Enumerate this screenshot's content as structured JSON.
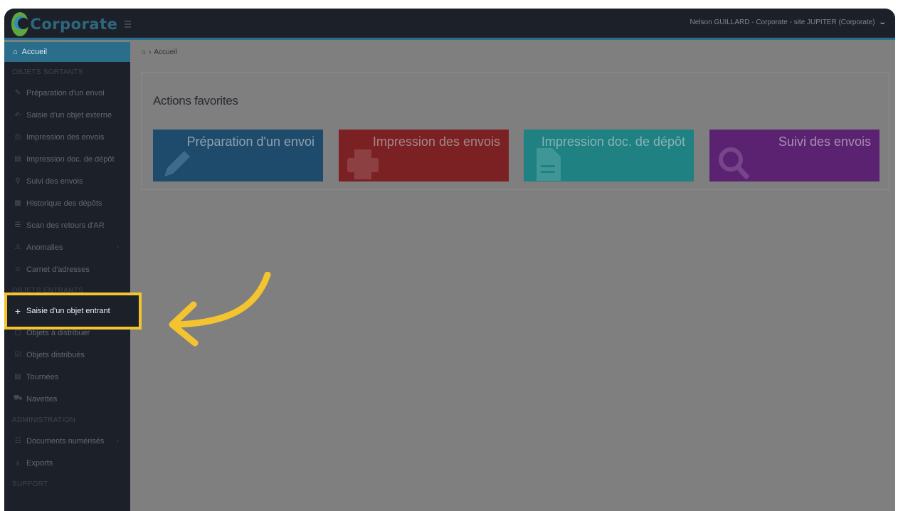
{
  "app": {
    "logo_text": "Corporate",
    "user": "Nelson GUILLARD - Corporate - site JUPITER (Corporate)"
  },
  "breadcrumb": {
    "label": "Accueil"
  },
  "sidebar": {
    "home": "Accueil",
    "sections": {
      "outgoing": "OBJETS SORTANTS",
      "incoming": "OBJETS ENTRANTS",
      "admin": "ADMINISTRATION",
      "support": "SUPPORT"
    },
    "outgoing_items": [
      {
        "label": "Préparation d'un envoi",
        "icon": "pencil-icon"
      },
      {
        "label": "Saisie d'un objet externe",
        "icon": "edit-icon"
      },
      {
        "label": "Impression des envois",
        "icon": "printer-icon"
      },
      {
        "label": "Impression doc. de dépôt",
        "icon": "file-icon"
      },
      {
        "label": "Suivi des envois",
        "icon": "search-icon"
      },
      {
        "label": "Historique des dépôts",
        "icon": "calendar-icon"
      },
      {
        "label": "Scan des retours d'AR",
        "icon": "barcode-icon"
      },
      {
        "label": "Anomalies",
        "icon": "warning-icon"
      },
      {
        "label": "Carnet d'adresses",
        "icon": "users-icon"
      }
    ],
    "incoming_items": [
      {
        "label": "Saisie d'un objet entrant",
        "icon": "plus-icon"
      },
      {
        "label": "Objets à distribuer",
        "icon": "box-icon"
      },
      {
        "label": "Objets distribués",
        "icon": "check-icon"
      },
      {
        "label": "Tournées",
        "icon": "cart-icon"
      },
      {
        "label": "Navettes",
        "icon": "truck-icon"
      }
    ],
    "admin_items": [
      {
        "label": "Documents numérisés",
        "icon": "scan-icon"
      },
      {
        "label": "Exports",
        "icon": "download-icon"
      }
    ]
  },
  "panel": {
    "title": "Actions favorites",
    "tiles": [
      {
        "label": "Préparation d'un envoi",
        "icon": "pencil-icon",
        "color": "#1e4a6c"
      },
      {
        "label": "Impression des envois",
        "icon": "printer-icon",
        "color": "#7b2124"
      },
      {
        "label": "Impression doc. de dépôt",
        "icon": "file-icon",
        "color": "#1f8181"
      },
      {
        "label": "Suivi des envois",
        "icon": "search-icon",
        "color": "#5c2272"
      }
    ]
  },
  "colors": {
    "highlight": "#f4c430",
    "accent": "#2a6e8c"
  }
}
